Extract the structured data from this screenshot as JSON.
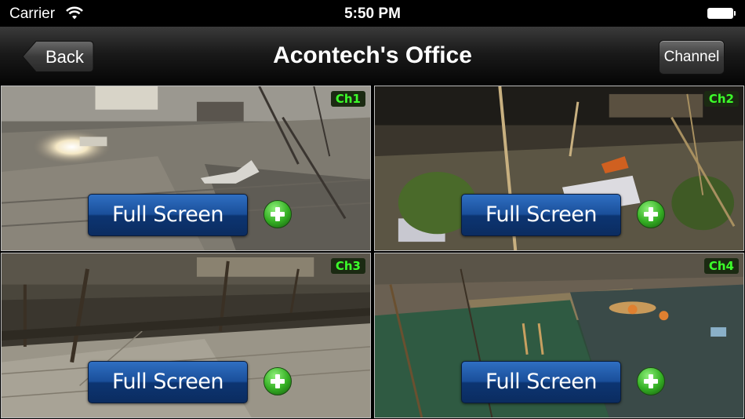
{
  "status_bar": {
    "carrier": "Carrier",
    "time": "5:50 PM"
  },
  "nav": {
    "title": "Acontech's Office",
    "back_label": "Back",
    "channel_label": "Channel"
  },
  "channels": [
    {
      "label": "Ch1",
      "button": "Full Screen"
    },
    {
      "label": "Ch2",
      "button": "Full Screen"
    },
    {
      "label": "Ch3",
      "button": "Full Screen"
    },
    {
      "label": "Ch4",
      "button": "Full Screen"
    }
  ],
  "icons": {
    "wifi": "wifi-icon",
    "battery": "battery-icon",
    "add": "plus-circle-icon"
  },
  "colors": {
    "channel_label": "#3cff2a",
    "button_blue": "#1a4f9a",
    "plus_green": "#3bbf2a"
  }
}
